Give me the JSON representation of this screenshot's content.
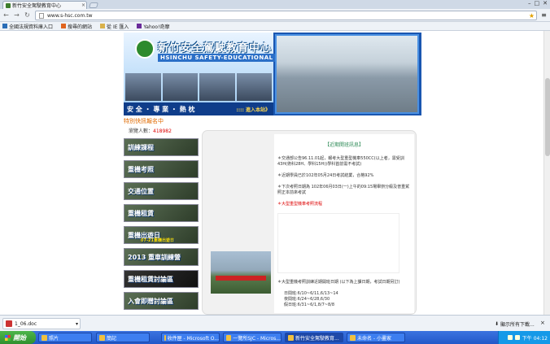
{
  "browser": {
    "tab_title": "新竹安全駕駛教育中心",
    "url": "www.s-hsc.com.tw",
    "window_buttons": [
      "–",
      "□",
      "✕"
    ],
    "bookmarks": [
      {
        "label": "全國法規資料庫入口",
        "icon": "doc-icon",
        "color": "#2a6db7"
      },
      {
        "label": "搜尋的網站",
        "icon": "search-site-icon",
        "color": "#e0641e"
      },
      {
        "label": "從 IE 匯入",
        "icon": "folder-icon",
        "color": "#d9b14a"
      },
      {
        "label": "Yahoo!奇摩",
        "icon": "yahoo-icon",
        "color": "#6a2b9a"
      }
    ]
  },
  "site": {
    "logo_title": "新竹安全駕駛教育中心",
    "logo_subtitle": "HSINCHU SAFETY-EDUCATIONAL CENTER",
    "slogan": "安 全 ・ 專 業 ・ 熱 枕",
    "enter_link": ":::: 進入本站》",
    "visitor_title": "特別快訊報名中",
    "visitor_label": "瀏覽人數：",
    "visitor_count": "418982",
    "menu": [
      {
        "label": "訓練課程",
        "sub": ""
      },
      {
        "label": "重機考照",
        "sub": ""
      },
      {
        "label": "交通位置",
        "sub": ""
      },
      {
        "label": "重機租賃",
        "sub": ""
      },
      {
        "label": "重機出遊日",
        "sub": "07-21重機出遊日"
      },
      {
        "label": "2013 重車訓練營",
        "sub": ""
      },
      {
        "label": "重機租賃討論區",
        "sub": ""
      },
      {
        "label": "入會即贈討論區",
        "sub": ""
      }
    ],
    "announcement_title": "【近期開班訊息】",
    "announcements": [
      "＊交通部公告96.11.01起，報考大型重型機車550CC(以上者，需受訓43H(術科28H、學科15H))學科首前需不考試)",
      "＊近期學員已於102年05月24日考試結業，合格92%",
      "＊下次考照日期為 102年06月03日(一)上午的09:15場舉辦分級及普重駕照正本前來考試"
    ],
    "process_link": "＊大型重型機車考照流程",
    "schedule_title": "＊大型重機考照訓練近期開班日期 (以下為上課日期，考試日期另訂)",
    "schedule": [
      "日間班:6/10~6/11,6/13~14",
      "夜間班:6/24~6/28,6/30",
      "假日班:6/31~6/1,8/7~8/8"
    ]
  },
  "download": {
    "file_name": "1_06.doc",
    "show_all": "顯示所有下載...",
    "close": "×"
  },
  "taskbar": {
    "start": "開始",
    "tasks": [
      {
        "label": "照片",
        "active": false
      },
      {
        "label": "簡記",
        "active": false
      },
      {
        "label": "收件匣 - Microsoft O...",
        "active": false
      },
      {
        "label": "一覽所SJC - Micros...",
        "active": false
      },
      {
        "label": "新竹安全駕駛教育...",
        "active": true
      },
      {
        "label": "未命名 - 小畫家",
        "active": false
      }
    ],
    "clock": "下午 04:12"
  }
}
